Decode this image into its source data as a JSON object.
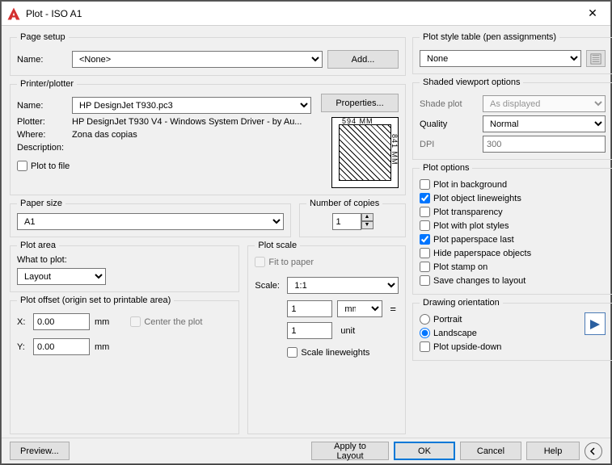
{
  "window": {
    "title": "Plot - ISO A1"
  },
  "pageSetup": {
    "legend": "Page setup",
    "nameLabel": "Name:",
    "nameValue": "<None>",
    "addBtn": "Add..."
  },
  "printer": {
    "legend": "Printer/plotter",
    "nameLabel": "Name:",
    "nameValue": "HP DesignJet T930.pc3",
    "propsBtn": "Properties...",
    "plotterLabel": "Plotter:",
    "plotterValue": "HP DesignJet T930 V4 - Windows System Driver - by Au...",
    "whereLabel": "Where:",
    "whereValue": "Zona das copias",
    "descLabel": "Description:",
    "plotToFile": "Plot to file",
    "dimW": "594 MM",
    "dimH": "841 MM"
  },
  "paperSize": {
    "legend": "Paper size",
    "value": "A1"
  },
  "copies": {
    "legend": "Number of copies",
    "value": "1"
  },
  "plotArea": {
    "legend": "Plot area",
    "whatLabel": "What to plot:",
    "whatValue": "Layout"
  },
  "plotScale": {
    "legend": "Plot scale",
    "fit": "Fit to paper",
    "scaleLabel": "Scale:",
    "scaleValue": "1:1",
    "num": "1",
    "numUnit": "mm",
    "den": "1",
    "denUnit": "unit",
    "scaleLw": "Scale lineweights"
  },
  "plotOffset": {
    "legend": "Plot offset (origin set to printable area)",
    "xLabel": "X:",
    "xVal": "0.00",
    "yLabel": "Y:",
    "yVal": "0.00",
    "unit": "mm",
    "center": "Center the plot"
  },
  "plotStyle": {
    "legend": "Plot style table (pen assignments)",
    "value": "None"
  },
  "shaded": {
    "legend": "Shaded viewport options",
    "shadeLabel": "Shade plot",
    "shadeValue": "As displayed",
    "qualityLabel": "Quality",
    "qualityValue": "Normal",
    "dpiLabel": "DPI",
    "dpiValue": "300"
  },
  "plotOptions": {
    "legend": "Plot options",
    "bg": "Plot in background",
    "lw": "Plot object lineweights",
    "tr": "Plot transparency",
    "ps": "Plot with plot styles",
    "pl": "Plot paperspace last",
    "hp": "Hide paperspace objects",
    "st": "Plot stamp on",
    "sv": "Save changes to layout"
  },
  "orient": {
    "legend": "Drawing orientation",
    "portrait": "Portrait",
    "landscape": "Landscape",
    "upside": "Plot upside-down"
  },
  "footer": {
    "preview": "Preview...",
    "apply": "Apply to Layout",
    "ok": "OK",
    "cancel": "Cancel",
    "help": "Help"
  }
}
